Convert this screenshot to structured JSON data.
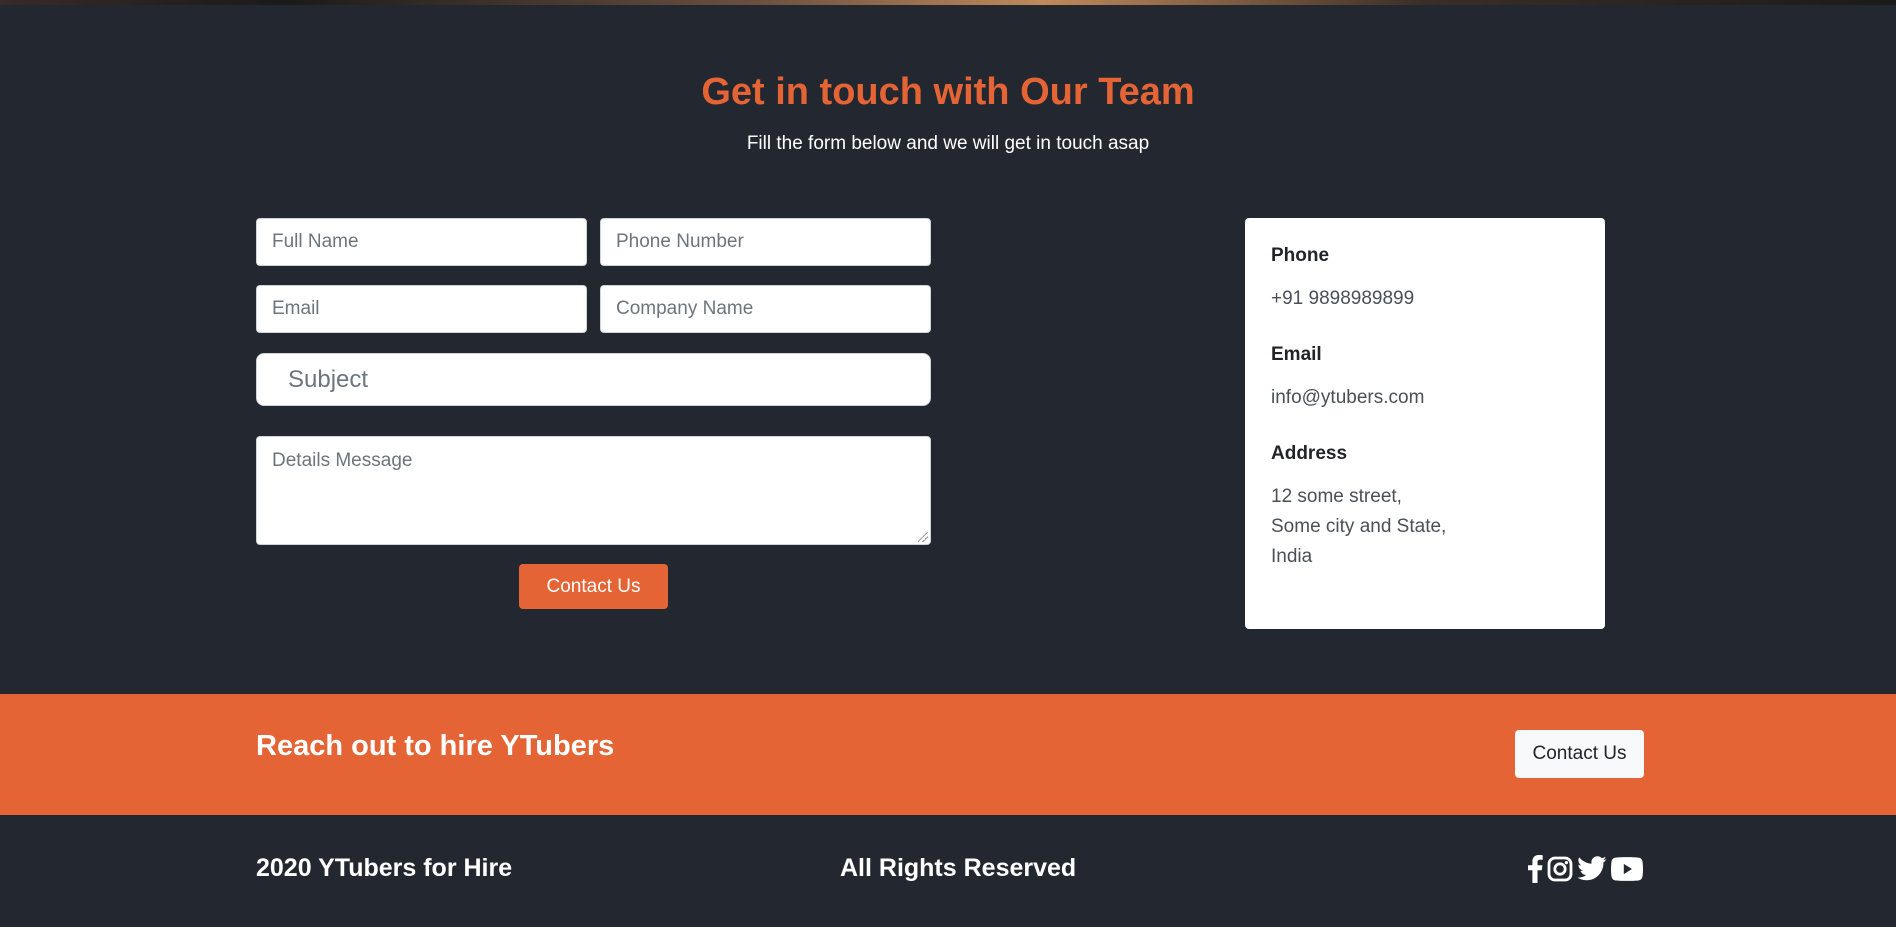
{
  "contact": {
    "heading": "Get in touch with Our Team",
    "subheading": "Fill the form below and we will get in touch asap",
    "form": {
      "full_name_placeholder": "Full Name",
      "phone_placeholder": "Phone Number",
      "email_placeholder": "Email",
      "company_placeholder": "Company Name",
      "subject_placeholder": "Subject",
      "message_placeholder": "Details Message",
      "submit_label": "Contact Us"
    },
    "info": {
      "phone_label": "Phone",
      "phone_value": "+91 9898989899",
      "email_label": "Email",
      "email_value": "info@ytubers.com",
      "address_label": "Address",
      "address_line1": "12 some street,",
      "address_line2": "Some city and State,",
      "address_line3": "India"
    }
  },
  "cta": {
    "text": "Reach out to hire YTubers",
    "button_label": "Contact Us"
  },
  "footer": {
    "left_text": "2020 YTubers for Hire",
    "center_text": "All Rights Reserved",
    "socials": [
      "facebook-icon",
      "instagram-icon",
      "twitter-icon",
      "youtube-icon"
    ]
  },
  "colors": {
    "accent": "#e56435",
    "background": "#232730"
  }
}
